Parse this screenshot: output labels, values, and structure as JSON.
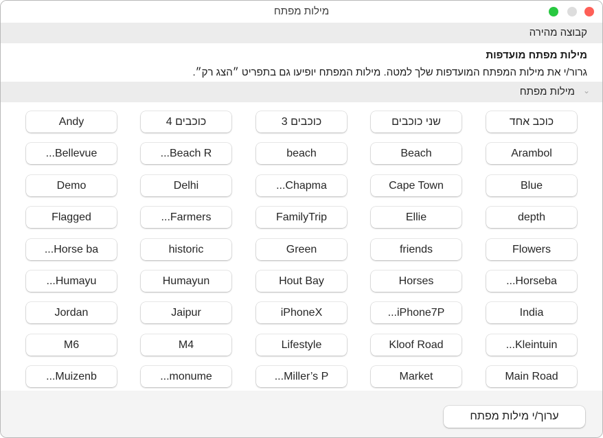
{
  "window": {
    "title": "מילות מפתח",
    "controls": {
      "close_color": "#fe5f57",
      "minimize_color": "#dddddd",
      "zoom_color": "#28c840"
    }
  },
  "quick_group": {
    "label": "קבוצה מהירה"
  },
  "favorites": {
    "title": "מילות מפתח מועדפות",
    "description": "גרור/י את מילות המפתח המועדפות שלך למטה. מילות המפתח יופיעו גם בתפריט ״הצג רק״."
  },
  "keywords_section": {
    "label": "מילות מפתח",
    "chevron": "chevron-down-icon"
  },
  "keywords": [
    [
      "כוכב אחד",
      "שני כוכבים",
      "3 כוכבים",
      "4 כוכבים",
      "Andy"
    ],
    [
      "Arambol",
      "Beach",
      "beach",
      "...Beach R",
      "...Bellevue"
    ],
    [
      "Blue",
      "Cape Town",
      "...Chapma",
      "Delhi",
      "Demo"
    ],
    [
      "depth",
      "Ellie",
      "FamilyTrip",
      "...Farmers",
      "Flagged"
    ],
    [
      "Flowers",
      "friends",
      "Green",
      "historic",
      "...Horse ba"
    ],
    [
      "...Horseba",
      "Horses",
      "Hout Bay",
      "Humayun",
      "...Humayu"
    ],
    [
      "India",
      "...iPhone7P",
      "iPhoneX",
      "Jaipur",
      "Jordan"
    ],
    [
      "...Kleintuin",
      "Kloof Road",
      "Lifestyle",
      "M4",
      "M6"
    ],
    [
      "Main Road",
      "Market",
      "...Miller’s P",
      "...monume",
      "...Muizenb"
    ]
  ],
  "footer": {
    "edit_button_label": "ערוך/י מילות מפתח"
  }
}
